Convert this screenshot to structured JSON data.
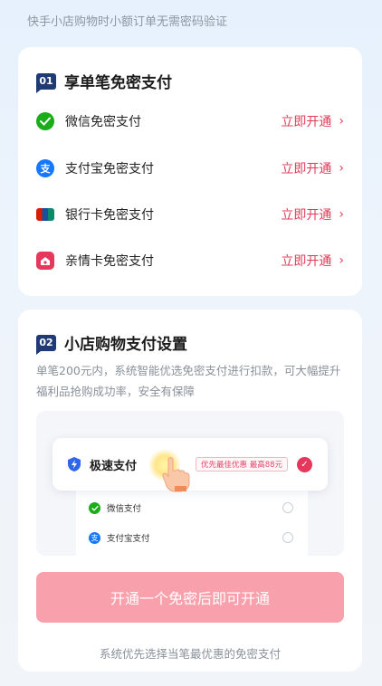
{
  "top_note": "快手小店购物时小额订单无需密码验证",
  "section1": {
    "number": "01",
    "title": "享单笔免密支付",
    "items": [
      {
        "label": "微信免密支付",
        "action": "立即开通",
        "icon": "wechat-pay-icon",
        "color": "#1aad19"
      },
      {
        "label": "支付宝免密支付",
        "action": "立即开通",
        "icon": "alipay-icon",
        "color": "#1677ff"
      },
      {
        "label": "银行卡免密支付",
        "action": "立即开通",
        "icon": "unionpay-card-icon",
        "color": "#d81e06"
      },
      {
        "label": "亲情卡免密支付",
        "action": "立即开通",
        "icon": "family-card-icon",
        "color": "#e6385c"
      }
    ]
  },
  "section2": {
    "number": "02",
    "title": "小店购物支付设置",
    "description": "单笔200元内，系统智能优选免密支付进行扣款，可大幅提升福利品抢购成功率，安全有保障",
    "illustration": {
      "fast_pay_label": "极速支付",
      "promo": "优先最佳优惠  最高88元",
      "options": [
        "微信支付",
        "支付宝支付"
      ]
    },
    "button_label": "开通一个免密后即可开通",
    "footer": "系统优先选择当笔最优惠的免密支付"
  },
  "colors": {
    "accent": "#e03c5a",
    "badge": "#1f3a75",
    "button": "#f8a1ad"
  }
}
